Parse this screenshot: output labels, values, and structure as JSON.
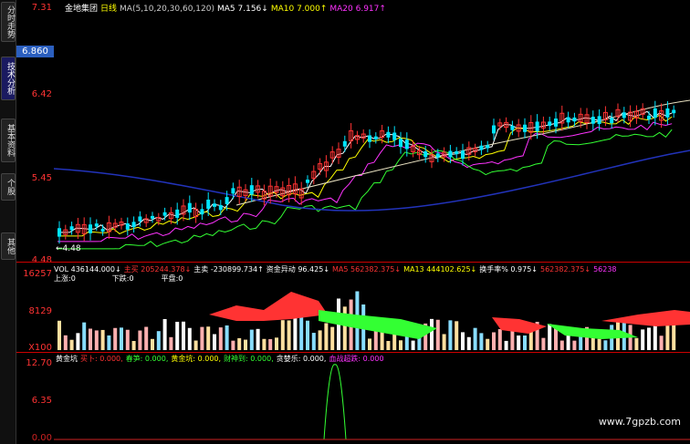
{
  "sidebar": {
    "tabs": [
      {
        "label": "分时走势",
        "active": false
      },
      {
        "label": "技术分析",
        "active": true
      },
      {
        "label": "基本资料",
        "active": false
      },
      {
        "label": "个股",
        "active": false
      },
      {
        "label": "其他",
        "active": false
      }
    ]
  },
  "axis": {
    "top_price": "7.31",
    "current_price": "6.860",
    "p642": "6.42",
    "p545": "5.45",
    "p448": "4.48",
    "low_mark": "4.48",
    "vol_top": "16257",
    "vol_mid": "8129",
    "vol_unit": "X100",
    "ind_top": "12.70",
    "ind_mid": "6.35",
    "ind_bot": "0.00"
  },
  "kline_header": {
    "name": "金地集团",
    "period": "日线",
    "ma_params": "MA(5,10,20,30,60,120)",
    "ma5": "MA5  7.156↓",
    "ma10": "MA10  7.000↑",
    "ma20": "MA20  6.917↑"
  },
  "vol_header": {
    "vol": "VOL 436144.000↓",
    "buy": "主买 205244.378↓",
    "sell": "主卖 -230899.734↑",
    "flow": "资金异动 96.425↓",
    "ma5": "MA5 562382.375↓",
    "ma13": "MA13 444102.625↓",
    "turnover": "换手率% 0.975↓",
    "extra": "562382.375↓",
    "extra2": "56238"
  },
  "vol_sub": {
    "up": "上涨:0",
    "down": "下跌:0",
    "flat": "平盘:0"
  },
  "ind_header": {
    "name": "黄金坑",
    "buy": "买卜: 0.000,",
    "spring": "春笋: 0.000,",
    "pit": "黄金坑: 0.000,",
    "god": "财神到: 0.000,",
    "greed": "贪婪乐: 0.000,",
    "limit": "血战超跌: 0.000"
  },
  "watermark": "www.7gpzb.com",
  "colors": {
    "red": "#ff3333",
    "green": "#33ff33",
    "cyan": "#00e5ff",
    "yellow": "#ffff00",
    "magenta": "#ff33ff",
    "blue": "#2233bb",
    "pink": "#ffb0b0"
  }
}
